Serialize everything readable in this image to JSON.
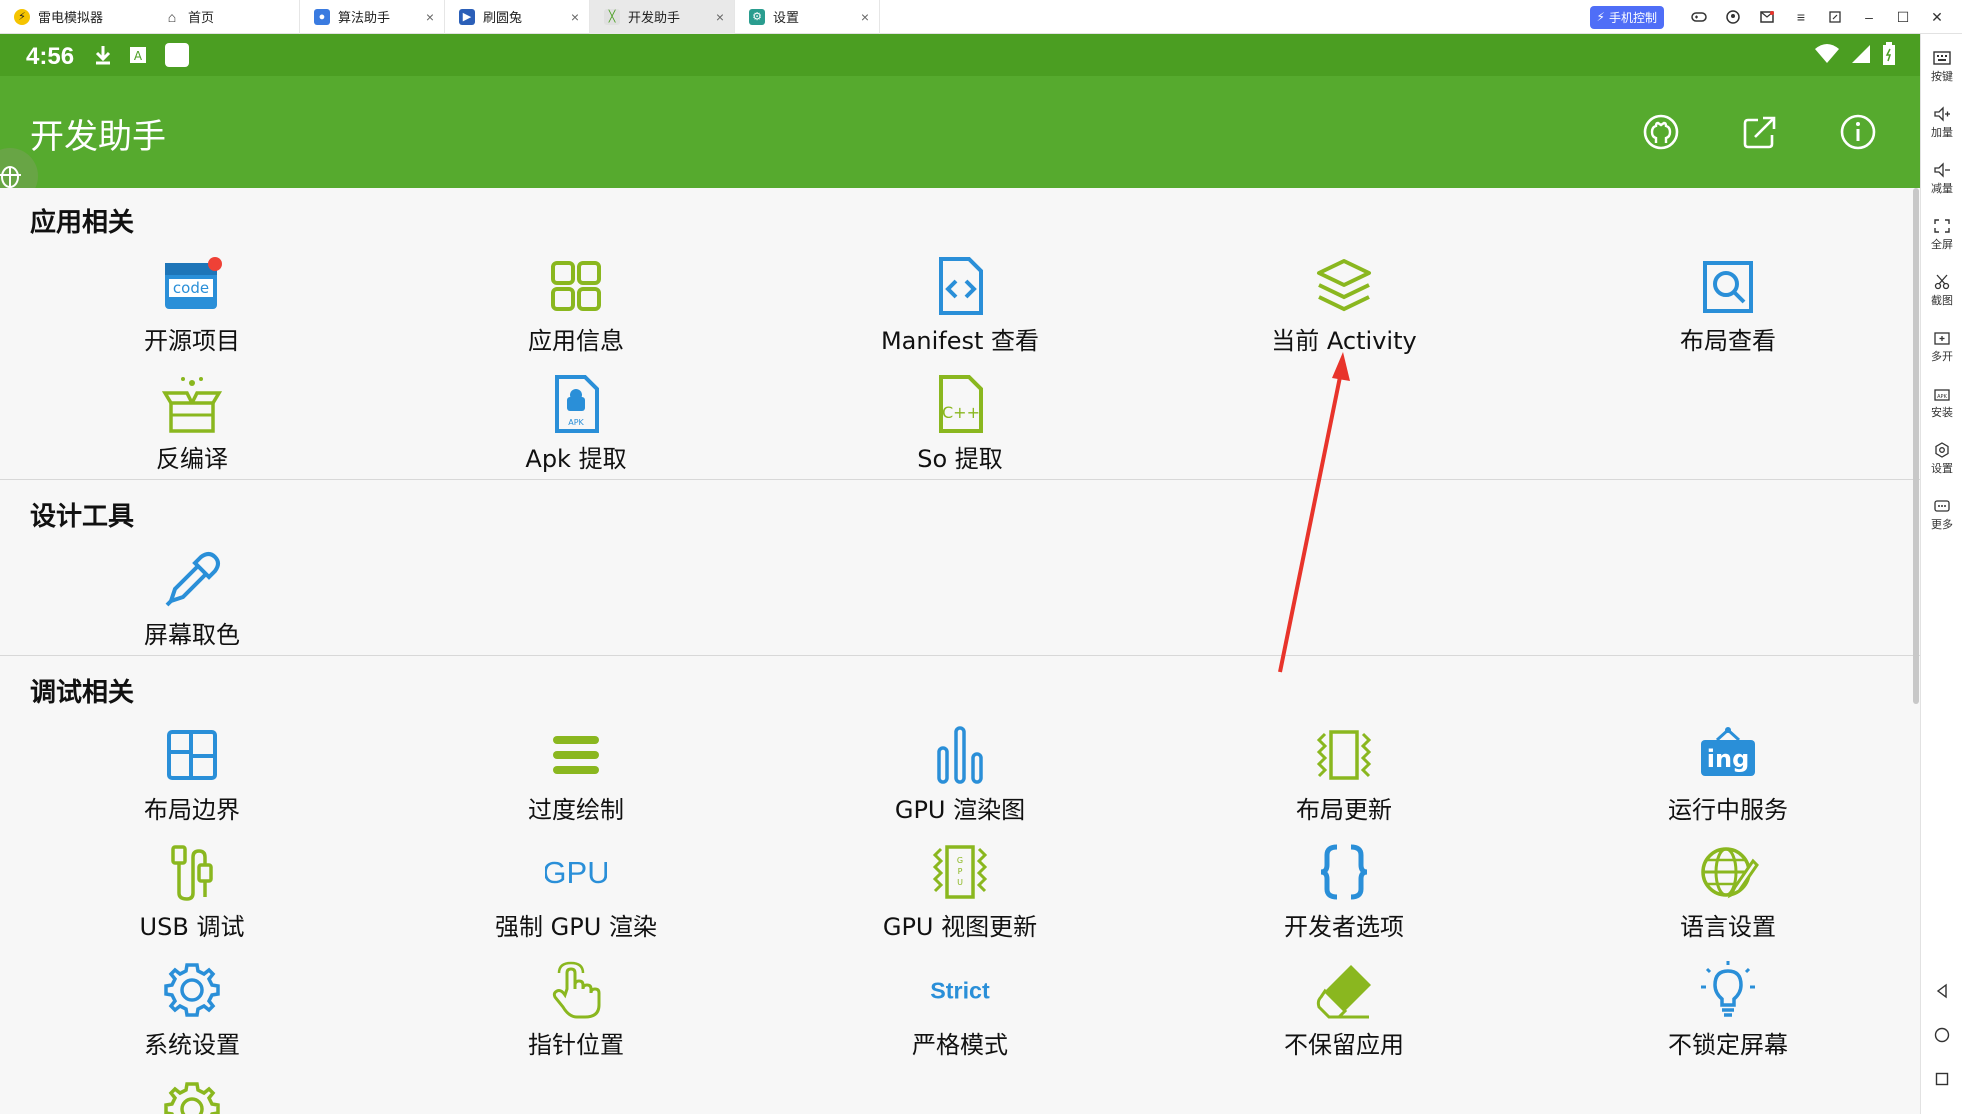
{
  "tabs": [
    {
      "label": "雷电模拟器",
      "icon": "leidian-logo-icon"
    },
    {
      "label": "首页",
      "icon": "home-icon"
    },
    {
      "label": "算法助手",
      "icon": "app-icon"
    },
    {
      "label": "刷圆兔",
      "icon": "app-icon"
    },
    {
      "label": "开发助手",
      "icon": "app-icon",
      "active": true
    },
    {
      "label": "设置",
      "icon": "gear-icon"
    }
  ],
  "phone_control": "手机控制",
  "status": {
    "time": "4:56"
  },
  "app": {
    "title": "开发助手"
  },
  "sections": [
    {
      "title": "应用相关",
      "items": [
        "开源项目",
        "应用信息",
        "Manifest 查看",
        "当前 Activity",
        "布局查看",
        "反编译",
        "Apk 提取",
        "So 提取"
      ]
    },
    {
      "title": "设计工具",
      "items": [
        "屏幕取色"
      ]
    },
    {
      "title": "调试相关",
      "items": [
        "布局边界",
        "过度绘制",
        "GPU 渲染图",
        "布局更新",
        "运行中服务",
        "USB 调试",
        "强制 GPU 渲染",
        "GPU 视图更新",
        "开发者选项",
        "语言设置",
        "系统设置",
        "指针位置",
        "严格模式",
        "不保留应用",
        "不锁定屏幕"
      ]
    }
  ],
  "icon_text": {
    "code": "code",
    "apk": "APK",
    "cpp": "C++",
    "ing": "ing",
    "gpu": "GPU",
    "strict": "Strict"
  },
  "sidebar": [
    "按键",
    "加量",
    "减量",
    "全屏",
    "截图",
    "多开",
    "安装",
    "设置",
    "更多"
  ],
  "colors": {
    "green_dark": "#4b9e22",
    "green": "#56aa2e",
    "blue": "#2a8fd8",
    "lime": "#8ab71f",
    "arrow": "#e8342b"
  }
}
